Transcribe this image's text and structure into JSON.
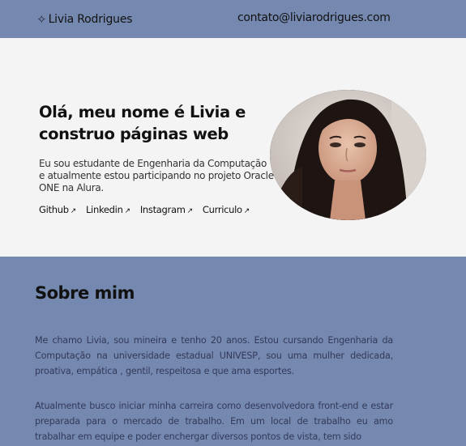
{
  "header": {
    "brand_icon": "sparkle-icon",
    "brand_name": "Livia Rodrigues",
    "email": "contato@liviarodrigues.com"
  },
  "hero": {
    "title": "Olá, meu nome é Livia e construo páginas web",
    "intro": "Eu sou estudante de Engenharia da Computação e atualmente estou participando no projeto Oracle ONE na Alura.",
    "links": [
      {
        "label": "Github",
        "icon": "arrow-up-right-icon"
      },
      {
        "label": "Linkedin",
        "icon": "arrow-up-right-icon"
      },
      {
        "label": "Instagram",
        "icon": "arrow-up-right-icon"
      },
      {
        "label": "Curriculo",
        "icon": "arrow-up-right-icon"
      }
    ]
  },
  "about": {
    "title": "Sobre mim",
    "paragraph1": "Me chamo Livia, sou mineira e tenho 20 anos. Estou cursando Engenharia da Computação na universidade estadual UNIVESP, sou uma mulher dedicada, proativa, empática , gentil, respeitosa e que ama esportes.",
    "paragraph2": "Atualmente busco iniciar minha carreira como desenvolvedora front-end e estar preparada para o mercado de trabalho. Em um local de trabalho eu amo trabalhar em equipe e poder enchergar diversos pontos de vista, tem sido"
  },
  "colors": {
    "header_bg": "#7589b0",
    "hero_bg": "#f4f4f4",
    "about_bg": "#7589b0"
  }
}
